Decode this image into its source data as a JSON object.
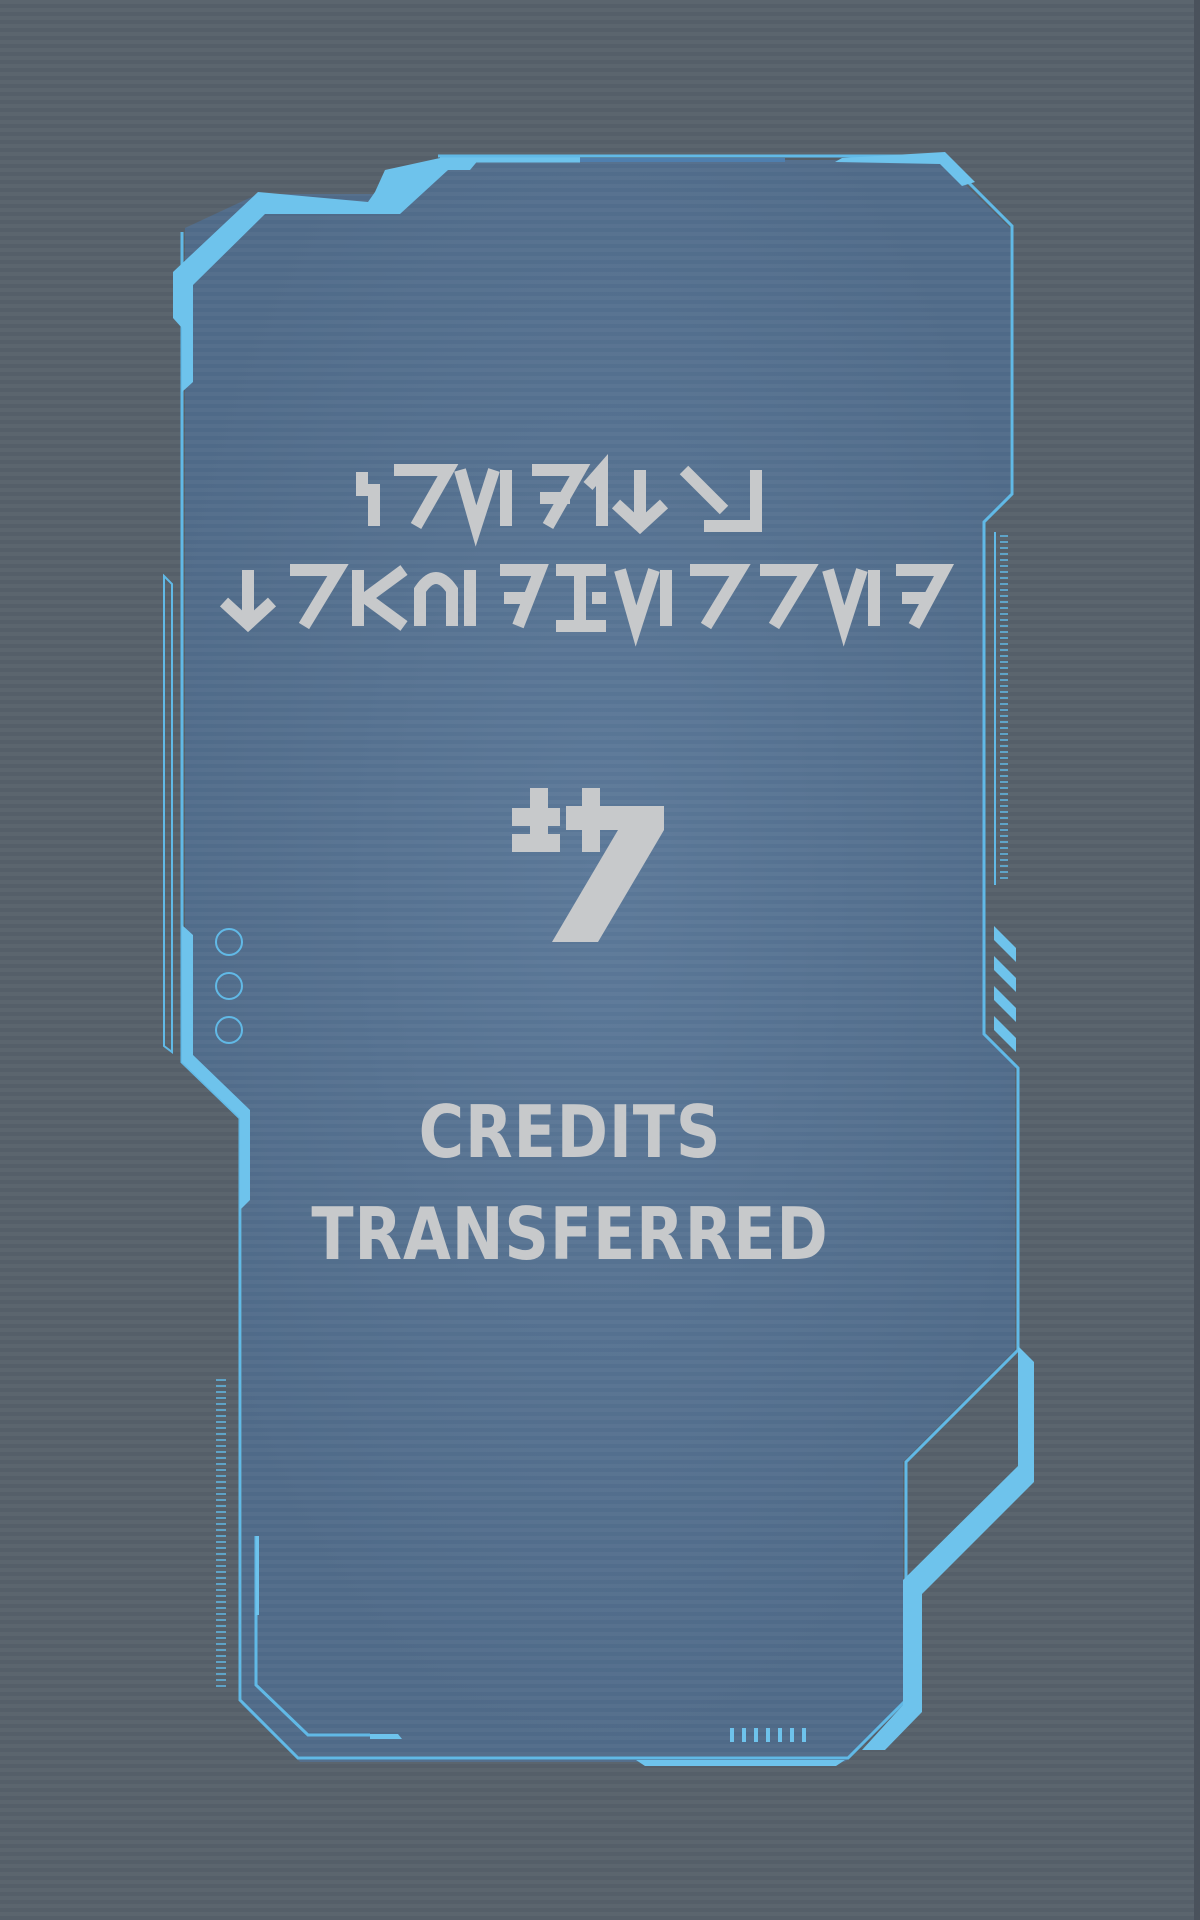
{
  "screen": {
    "background": "#555f69",
    "panel_fill": "#55708e",
    "frame_accent": "#6ec3ec",
    "frame_line": "#61b9e6",
    "text_color": "#c7c9cb"
  },
  "glyph_heading": {
    "script": "aurebesh",
    "line_1": "ꞁ7VI71↓ꓘ",
    "line_2": "↓7KᑎᗅꟻꝈVI77VIꟻ"
  },
  "amount_glyph": "aurebesh-numeral",
  "caption": {
    "line_1": "CREDITS",
    "line_2": "TRANSFERRED"
  },
  "decor": {
    "left_rings": 3,
    "right_slashes": 4,
    "bottom_ticks": 7
  }
}
